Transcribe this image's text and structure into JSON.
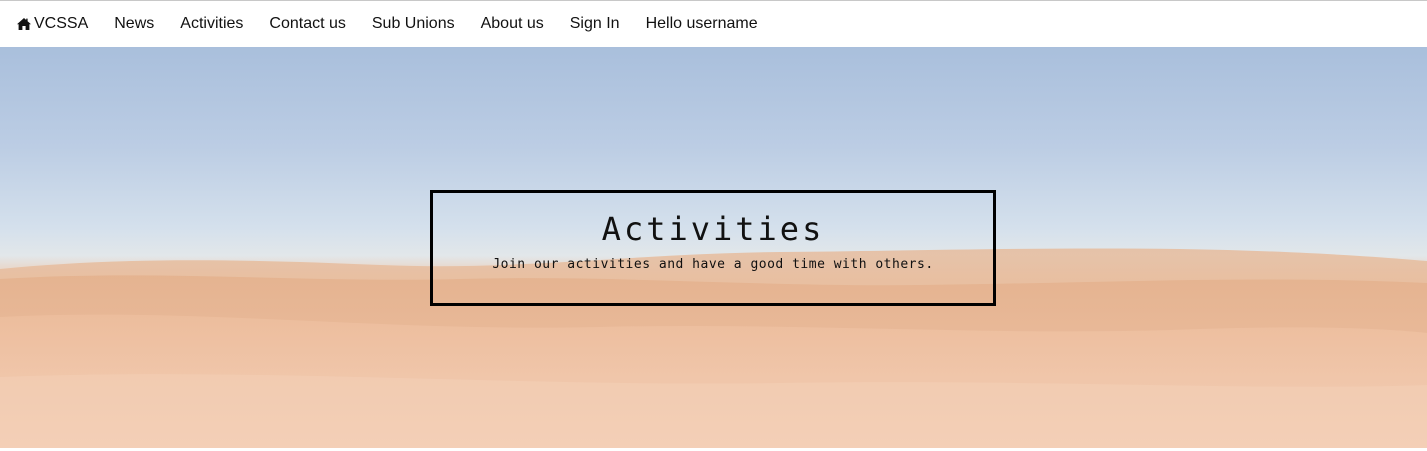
{
  "navbar": {
    "brand": {
      "icon": "home-icon",
      "label": "VCSSA"
    },
    "items": [
      {
        "label": "News"
      },
      {
        "label": "Activities"
      },
      {
        "label": "Contact us"
      },
      {
        "label": "Sub Unions"
      },
      {
        "label": "About us"
      },
      {
        "label": "Sign In"
      },
      {
        "label": "Hello username"
      }
    ]
  },
  "hero": {
    "title": "Activities",
    "subtitle": "Join our activities and have a good time with others.",
    "background": "desert-dunes-image"
  },
  "colors": {
    "sky": "#bccde4",
    "sand": "#edc2a4",
    "text": "#111111",
    "border": "#000000"
  }
}
